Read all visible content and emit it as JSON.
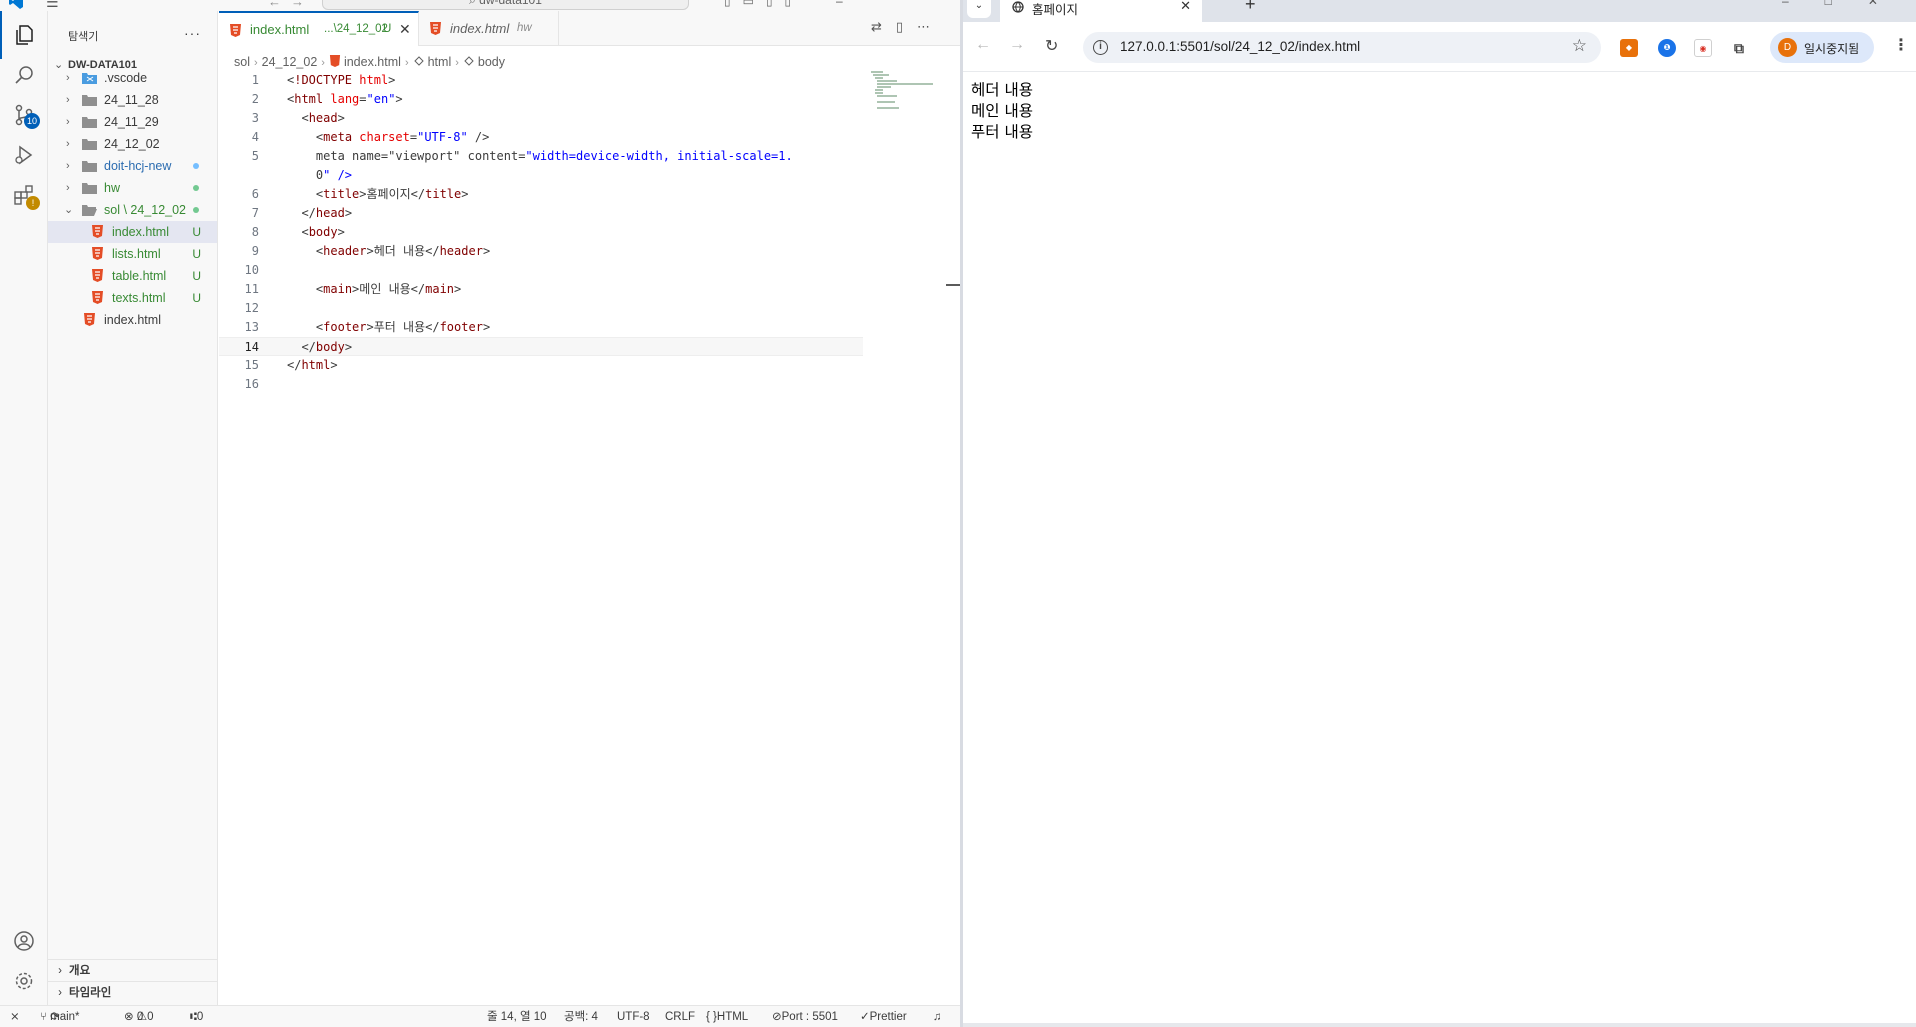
{
  "vscode": {
    "titlebar": {
      "command_center": "dw-data101",
      "nav_icons": [
        "arrow-left-icon",
        "arrow-right-icon"
      ]
    },
    "activity": {
      "scm_badge": "10",
      "icons": [
        "explorer-icon",
        "search-icon",
        "source-control-icon",
        "run-debug-icon",
        "extensions-icon",
        "account-icon",
        "settings-gear-icon"
      ]
    },
    "explorer": {
      "title": "탐색기",
      "more": "···",
      "workspace": "DW-DATA101",
      "items": [
        {
          "label": ".vscode",
          "type": "folder",
          "open": false
        },
        {
          "label": "24_11_28",
          "type": "folder",
          "open": false
        },
        {
          "label": "24_11_29",
          "type": "folder",
          "open": false
        },
        {
          "label": "24_12_02",
          "type": "folder",
          "open": false
        },
        {
          "label": "doit-hcj-new",
          "type": "folder",
          "open": false
        },
        {
          "label": "hw",
          "type": "folder",
          "open": false
        },
        {
          "label": "sol \\ 24_12_02",
          "type": "folder",
          "open": true
        },
        {
          "label": "index.html",
          "type": "file",
          "status": "U"
        },
        {
          "label": "lists.html",
          "type": "file",
          "status": "U"
        },
        {
          "label": "table.html",
          "type": "file",
          "status": "U"
        },
        {
          "label": "texts.html",
          "type": "file",
          "status": "U"
        },
        {
          "label": "index.html",
          "type": "file",
          "status": ""
        }
      ],
      "outline": "개요",
      "timeline": "타임라인"
    },
    "tabs": [
      {
        "name": "index.html",
        "desc": "...\\24_12_02",
        "status": "U",
        "close": "✕",
        "active": true
      },
      {
        "name": "index.html",
        "desc": "hw",
        "active": false
      }
    ],
    "breadcrumb": [
      "sol",
      "24_12_02",
      "index.html",
      "html",
      "body"
    ],
    "code_lines": [
      {
        "n": "1",
        "t": "<!DOCTYPE html>"
      },
      {
        "n": "2",
        "t": "<html lang=\"en\">"
      },
      {
        "n": "3",
        "t": "  <head>"
      },
      {
        "n": "4",
        "t": "    <meta charset=\"UTF-8\" />"
      },
      {
        "n": "5",
        "t": "    <meta name=\"viewport\" content=\"width=device-width, initial-scale=1."
      },
      {
        "n": "",
        "t": "    0\" />"
      },
      {
        "n": "6",
        "t": "    <title>홈페이지</title>"
      },
      {
        "n": "7",
        "t": "  </head>"
      },
      {
        "n": "8",
        "t": "  <body>"
      },
      {
        "n": "9",
        "t": "    <header>헤더 내용</header>"
      },
      {
        "n": "10",
        "t": ""
      },
      {
        "n": "11",
        "t": "    <main>메인 내용</main>"
      },
      {
        "n": "12",
        "t": ""
      },
      {
        "n": "13",
        "t": "    <footer>푸터 내용</footer>"
      },
      {
        "n": "14",
        "t": "  </body>"
      },
      {
        "n": "15",
        "t": "</html>"
      },
      {
        "n": "16",
        "t": ""
      }
    ],
    "status": {
      "branch": "main*",
      "errors": "0",
      "warnings": "0",
      "ports": "0",
      "position": "줄 14, 열 10",
      "spaces": "공백: 4",
      "encoding": "UTF-8",
      "eol": "CRLF",
      "language": "HTML",
      "port": "Port : 5501",
      "formatter": "Prettier"
    }
  },
  "chrome": {
    "tab_title": "홈페이지",
    "url": "127.0.0.1:5501/sol/24_12_02/index.html",
    "profile_initial": "D",
    "profile_status": "일시중지됨",
    "page_lines": [
      "헤더 내용",
      "메인 내용",
      "푸터 내용"
    ],
    "colors": {
      "ext1": "#e8710a",
      "ext2": "#1a73e8",
      "ext3": "#d93025"
    }
  }
}
